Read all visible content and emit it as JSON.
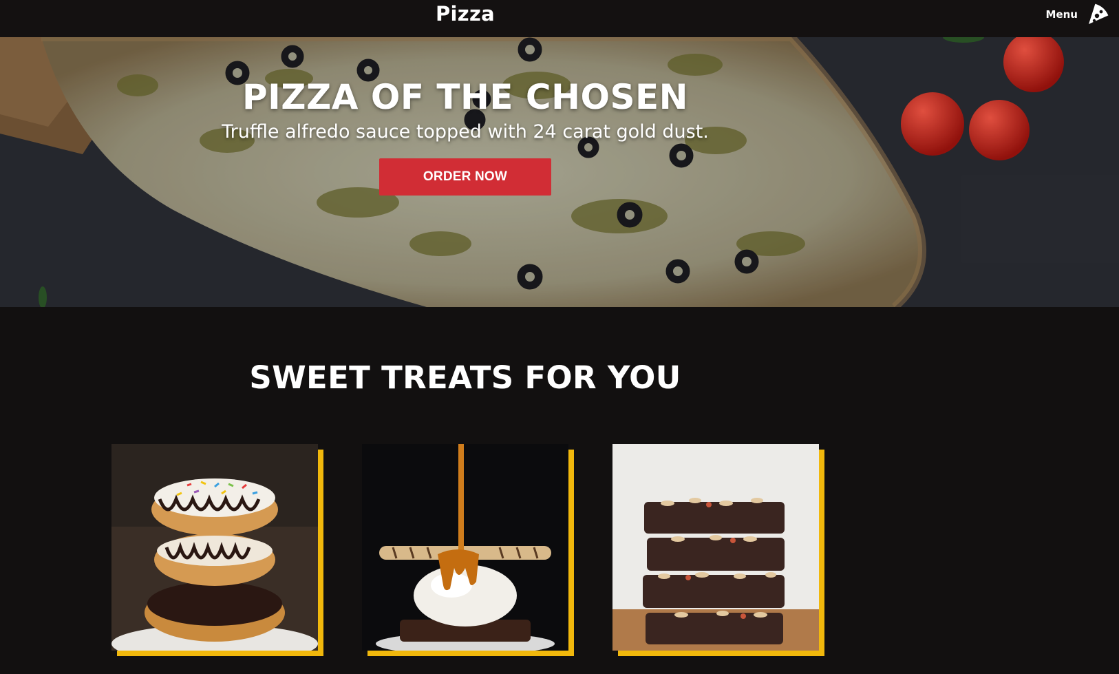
{
  "nav": {
    "brand": "Pizza",
    "menu_label": "Menu",
    "menu_icon": "pizza-slice-icon"
  },
  "hero": {
    "title": "PIZZA OF THE CHOSEN",
    "subtitle": "Truffle alfredo sauce topped with 24 carat gold dust.",
    "cta_label": "ORDER NOW",
    "cta_color": "#d12d35"
  },
  "treats": {
    "title": "SWEET TREATS FOR YOU",
    "accent_color": "#f1b80c",
    "items": [
      {
        "image": "stacked-donuts"
      },
      {
        "image": "caramel-ice-cream-brownie"
      },
      {
        "image": "stacked-brownies"
      }
    ]
  },
  "colors": {
    "page_bg": "#121010",
    "navbar_bg": "#141111"
  }
}
